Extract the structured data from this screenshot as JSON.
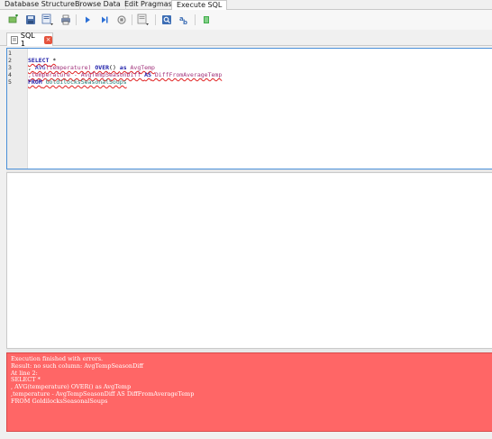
{
  "main_tabs": [
    {
      "label": "Database Structure"
    },
    {
      "label": "Browse Data"
    },
    {
      "label": "Edit Pragmas"
    },
    {
      "label": "Execute SQL",
      "active": true
    }
  ],
  "toolbar": {
    "buttons": [
      {
        "icon": "open-tab-icon"
      },
      {
        "icon": "open-sql-file-icon"
      },
      {
        "icon": "save-sql-file-icon"
      },
      {
        "icon": "print-icon"
      },
      {
        "icon": "execute-all-icon"
      },
      {
        "icon": "execute-current-line-icon"
      },
      {
        "icon": "stop-icon"
      },
      {
        "icon": "save-results-icon"
      },
      {
        "icon": "find-icon"
      },
      {
        "icon": "find-replace-icon"
      },
      {
        "icon": "comment-icon"
      }
    ]
  },
  "editor_tab": {
    "label": "SQL 1",
    "close_label": "×"
  },
  "editor": {
    "line_numbers": [
      "1",
      "2",
      "3",
      "4",
      "5"
    ],
    "lines": [
      [],
      [
        {
          "t": "SELECT",
          "c": "kw"
        },
        {
          "t": " *",
          "c": "op"
        }
      ],
      [
        {
          "t": ", ",
          "c": "op"
        },
        {
          "t": "AVG",
          "c": "fn"
        },
        {
          "t": "(temperature) ",
          "c": "id"
        },
        {
          "t": "OVER",
          "c": "kw"
        },
        {
          "t": "() ",
          "c": "op"
        },
        {
          "t": "as",
          "c": "kw"
        },
        {
          "t": " AvgTemp",
          "c": "id"
        }
      ],
      [
        {
          "t": ",temperature - AvgTempSeasonDiff ",
          "c": "id"
        },
        {
          "t": "AS",
          "c": "kw"
        },
        {
          "t": " DiffFromAverageTemp",
          "c": "id"
        }
      ],
      [
        {
          "t": "FROM",
          "c": "kw"
        },
        {
          "t": " GoldilocksSeasonalSoups",
          "c": "tbl"
        }
      ]
    ]
  },
  "message": {
    "lines": [
      "Execution finished with errors.",
      "Result: no such column: AvgTempSeasonDiff",
      "At line 2:",
      "SELECT *",
      ", AVG(temperature) OVER() as AvgTemp",
      ",temperature - AvgTempSeasonDiff AS DiffFromAverageTemp",
      "FROM GoldilocksSeasonalSoups"
    ]
  },
  "colors": {
    "error_background": "#ff6666",
    "editor_border": "#4a90d9",
    "keyword": "#1c1ca8",
    "identifier": "#a0307a",
    "table_name": "#1c7a74"
  }
}
